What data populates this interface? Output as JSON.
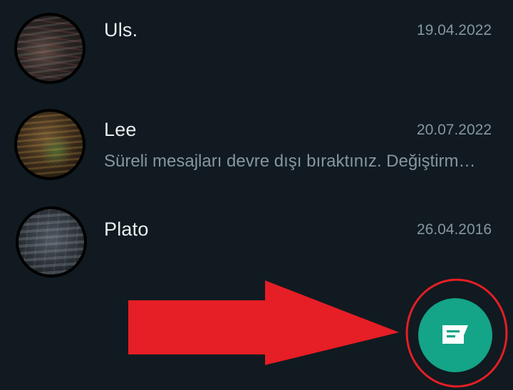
{
  "chats": [
    {
      "name": "Uls.",
      "date": "19.04.2022",
      "preview": ""
    },
    {
      "name": "Lee",
      "date": "20.07.2022",
      "preview": "Süreli mesajları devre dışı bıraktınız. Değiştirmek için dokunun."
    },
    {
      "name": "Plato",
      "date": "26.04.2016",
      "preview": ""
    }
  ],
  "fab": {
    "icon": "new-chat-icon",
    "color": "#14a487"
  },
  "colors": {
    "background": "#101a20",
    "name_text": "#e9edef",
    "secondary_text": "#8696a0",
    "annotation_red": "#e61e25"
  }
}
